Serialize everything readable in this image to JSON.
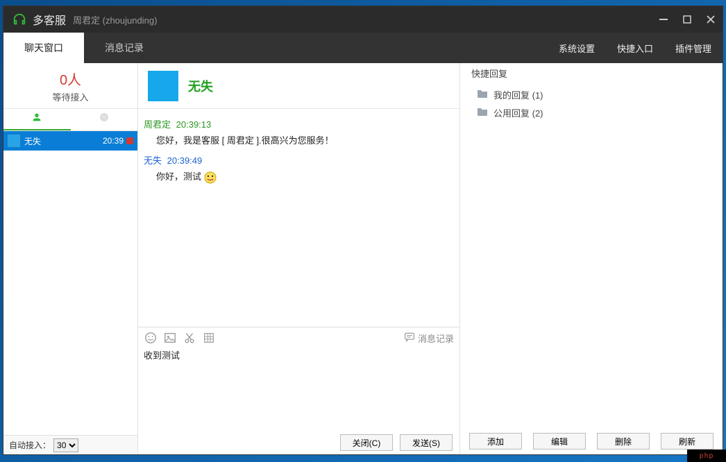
{
  "titlebar": {
    "app_name": "多客服",
    "user_display": "周君定 (zhoujunding)"
  },
  "menubar": {
    "tabs": [
      {
        "label": "聊天窗口",
        "active": true
      },
      {
        "label": "消息记录",
        "active": false
      }
    ],
    "links": [
      {
        "label": "系统设置"
      },
      {
        "label": "快捷入口"
      },
      {
        "label": "插件管理"
      }
    ]
  },
  "sidebar": {
    "waiting_count": "0人",
    "waiting_label": "等待接入",
    "conversations": [
      {
        "name": "无失",
        "time": "20:39",
        "unread": true
      }
    ],
    "auto_accept_label": "自动接入：",
    "auto_accept_value": "30"
  },
  "chat": {
    "header_name": "无失",
    "messages": [
      {
        "sender": "周君定",
        "time": "20:39:13",
        "text": "您好，我是客服 [ 周君定 ].很高兴为您服务！",
        "role": "agent"
      },
      {
        "sender": "无失",
        "time": "20:39:49",
        "text": "你好，测试",
        "role": "customer",
        "emoji": true
      }
    ],
    "history_button": "消息记录",
    "composer_text": "收到测试",
    "close_btn": "关闭(C)",
    "send_btn": "发送(S)"
  },
  "right_panel": {
    "title": "快捷回复",
    "folders": [
      {
        "label": "我的回复 (1)"
      },
      {
        "label": "公用回复 (2)"
      }
    ],
    "buttons": {
      "add": "添加",
      "edit": "编辑",
      "delete": "删除",
      "refresh": "刷新"
    }
  },
  "watermark": "php"
}
